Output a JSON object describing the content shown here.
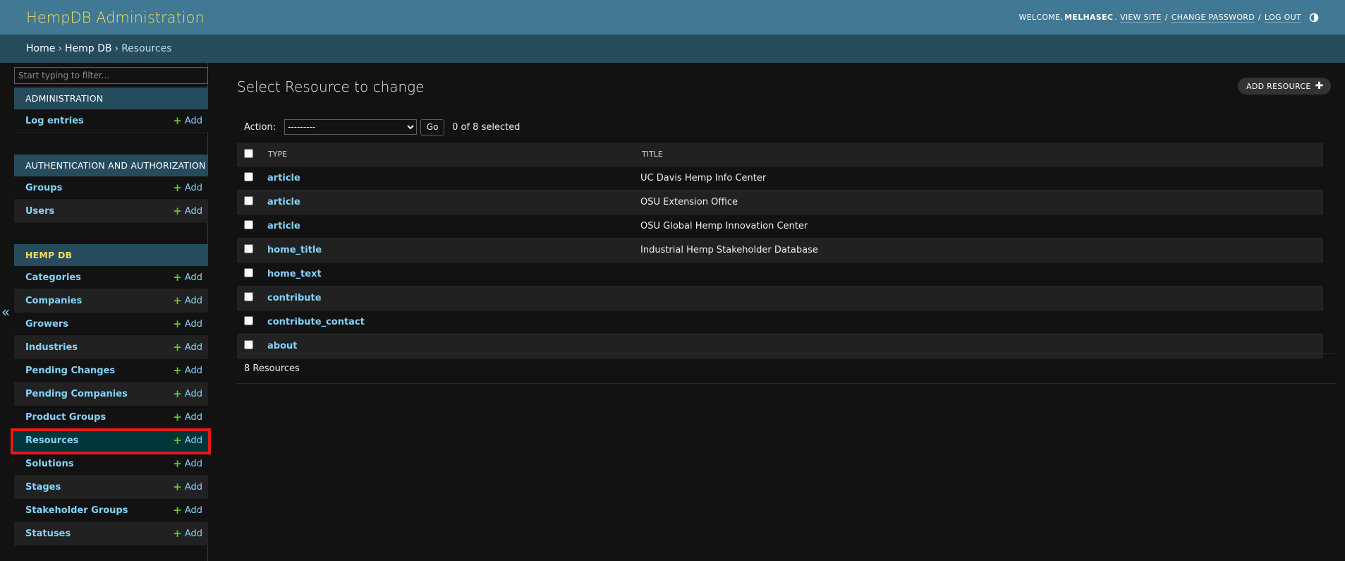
{
  "header": {
    "branding": "HempDB Administration",
    "welcome": "WELCOME,",
    "username": "MELHASEC",
    "dot": ".",
    "view_site": "VIEW SITE",
    "change_password": "CHANGE PASSWORD",
    "log_out": "LOG OUT",
    "separator": "/"
  },
  "breadcrumbs": {
    "home": "Home",
    "app": "Hemp DB",
    "current": "Resources",
    "sep": "›"
  },
  "sidebar": {
    "filter_placeholder": "Start typing to filter...",
    "collapse_glyph": "«",
    "add_label": "Add",
    "modules": [
      {
        "caption": "Administration",
        "items": [
          {
            "label": "Log entries"
          }
        ]
      },
      {
        "caption": "Authentication and Authorization",
        "items": [
          {
            "label": "Groups"
          },
          {
            "label": "Users"
          }
        ]
      },
      {
        "caption": "Hemp DB",
        "items": [
          {
            "label": "Categories"
          },
          {
            "label": "Companies"
          },
          {
            "label": "Growers"
          },
          {
            "label": "Industries"
          },
          {
            "label": "Pending Changes"
          },
          {
            "label": "Pending Companies"
          },
          {
            "label": "Product Groups"
          },
          {
            "label": "Resources"
          },
          {
            "label": "Solutions"
          },
          {
            "label": "Stages"
          },
          {
            "label": "Stakeholder Groups"
          },
          {
            "label": "Statuses"
          }
        ]
      }
    ]
  },
  "content": {
    "title": "Select Resource to change",
    "add_button": "ADD RESOURCE",
    "action_label": "Action:",
    "action_selected": "---------",
    "go": "Go",
    "selection_counter": "0 of 8 selected",
    "columns": {
      "type": "TYPE",
      "title": "TITLE"
    },
    "rows": [
      {
        "type": "article",
        "title": "UC Davis Hemp Info Center"
      },
      {
        "type": "article",
        "title": "OSU Extension Office"
      },
      {
        "type": "article",
        "title": "OSU Global Hemp Innovation Center"
      },
      {
        "type": "home_title",
        "title": "Industrial Hemp Stakeholder Database"
      },
      {
        "type": "home_text",
        "title": ""
      },
      {
        "type": "contribute",
        "title": ""
      },
      {
        "type": "contribute_contact",
        "title": ""
      },
      {
        "type": "about",
        "title": ""
      }
    ],
    "paginator": "8 Resources"
  },
  "colors": {
    "header_bg": "#417893",
    "breadcrumbs_bg": "#264b5d",
    "branding": "#f5dd5d",
    "link": "#81d4fa",
    "add_plus": "#70bf2b",
    "highlight_box": "#e61919",
    "selected_row": "#00363a",
    "body_bg": "#121212"
  },
  "icons": {
    "theme_toggle": "contrast-icon",
    "add": "plus-icon",
    "collapse": "double-chevron-left-icon"
  }
}
